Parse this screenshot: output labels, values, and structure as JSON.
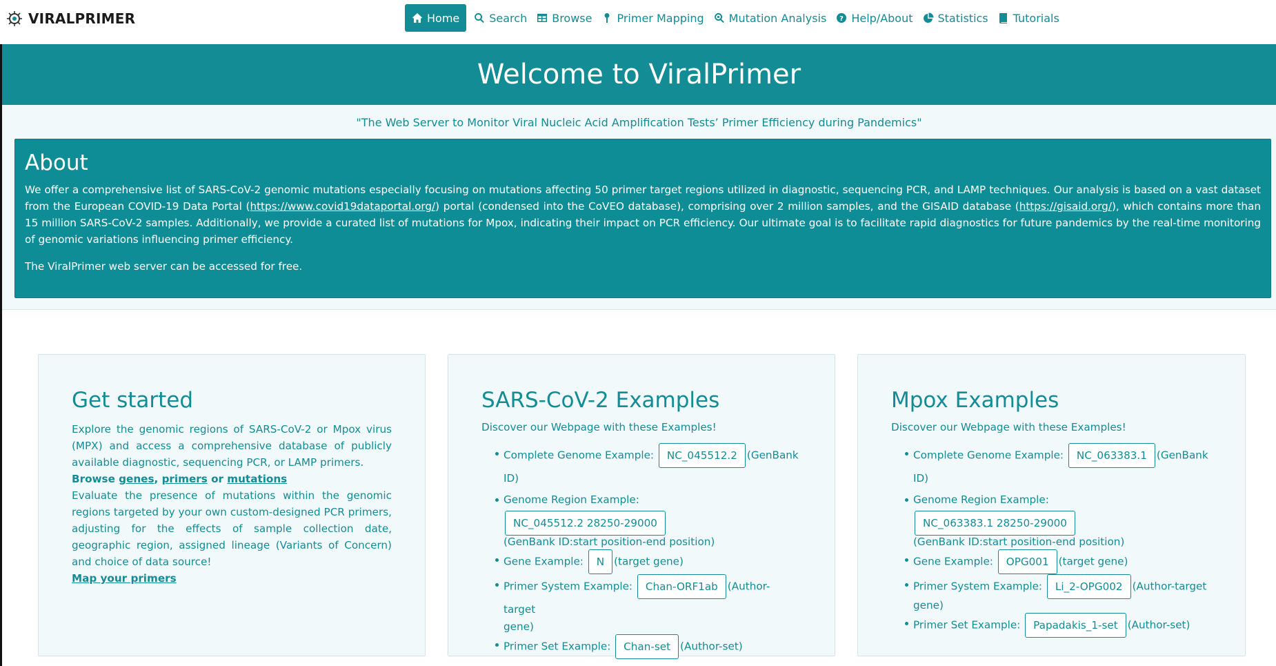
{
  "brand": {
    "name": "VIRALPRIMER"
  },
  "nav": {
    "items": [
      {
        "label": "Home",
        "icon": "home-icon",
        "active": true
      },
      {
        "label": "Search",
        "icon": "search-icon"
      },
      {
        "label": "Browse",
        "icon": "table-icon"
      },
      {
        "label": "Primer Mapping",
        "icon": "map-pin-icon"
      },
      {
        "label": "Mutation Analysis",
        "icon": "search-mutation-icon"
      },
      {
        "label": "Help/About",
        "icon": "question-circle-icon"
      },
      {
        "label": "Statistics",
        "icon": "pie-chart-icon"
      },
      {
        "label": "Tutorials",
        "icon": "book-icon"
      }
    ]
  },
  "hero": {
    "title": "Welcome to ViralPrimer"
  },
  "tagline": "\"The Web Server to Monitor Viral Nucleic Acid Amplification Tests’ Primer Efficiency during Pandemics\"",
  "about": {
    "title": "About",
    "p1_a": "We offer a comprehensive list of SARS-CoV-2 genomic mutations especially focusing on mutations affecting 50 primer target regions utilized in diagnostic, sequencing PCR, and LAMP techniques. Our analysis is based on a vast dataset from the European COVID-19 Data Portal (",
    "link1": "https://www.covid19dataportal.org/",
    "p1_b": ") portal (condensed into the CoVEO database), comprising over 2 million samples, and the GISAID database (",
    "link2": "https://gisaid.org/",
    "p1_c": "), which contains more than 15 million SARS-CoV-2 samples. Additionally, we provide a curated list of mutations for Mpox, indicating their impact on PCR efficiency. Our ultimate goal is to facilitate rapid diagnostics for future pandemics by the real-time monitoring of genomic variations influencing primer efficiency.",
    "p2": "The ViralPrimer web server can be accessed for free."
  },
  "get_started": {
    "title": "Get started",
    "p1": "Explore the genomic regions of SARS-CoV-2 or Mpox virus (MPX) and access a comprehensive database of publicly available diagnostic, sequencing PCR, or LAMP primers.",
    "browse_prefix": "Browse ",
    "link_genes": "genes",
    "comma": ", ",
    "link_primers": "primers",
    "or": " or ",
    "link_mutations": "mutations",
    "p2": "Evaluate the presence of mutations within the genomic regions targeted by your own custom-designed PCR primers, adjusting for the effects of sample collection date, geographic region, assigned lineage (Variants of Concern) and choice of data source!",
    "link_map": "Map your primers"
  },
  "sars": {
    "title": "SARS-CoV-2 Examples",
    "subtitle": "Discover our Webpage with these Examples!",
    "items": [
      {
        "label": "Complete Genome Example:",
        "value": "NC_045512.2",
        "note": "(GenBank ID)"
      },
      {
        "label": "Genome Region Example:",
        "value": "NC_045512.2 28250-29000",
        "note": "(GenBank ID:start position-end position)"
      },
      {
        "label": "Gene Example:",
        "value": "N",
        "note": "(target gene)"
      },
      {
        "label": "Primer System Example:",
        "value": "Chan-ORF1ab",
        "note": "(Author-target",
        "note2": "gene)"
      },
      {
        "label": "Primer Set Example:",
        "value": "Chan-set",
        "note": "(Author-set)"
      }
    ]
  },
  "mpox": {
    "title": "Mpox Examples",
    "subtitle": "Discover our Webpage with these Examples!",
    "items": [
      {
        "label": "Complete Genome Example:",
        "value": "NC_063383.1",
        "note": "(GenBank ID)"
      },
      {
        "label": "Genome Region Example:",
        "value": "NC_063383.1 28250-29000",
        "note": "(GenBank ID:start position-end position)"
      },
      {
        "label": "Gene Example:",
        "value": "OPG001",
        "note": "(target gene)"
      },
      {
        "label": "Primer System Example:",
        "value": "Li_2-OPG002",
        "note": "(Author-target",
        "note2": "gene)"
      },
      {
        "label": "Primer Set Example:",
        "value": "Papadakis_1-set",
        "note": "(Author-set)"
      }
    ]
  },
  "colors": {
    "primary": "#138c95",
    "about_bg": "#0e8d96",
    "band_bg": "#f1f9fb"
  }
}
